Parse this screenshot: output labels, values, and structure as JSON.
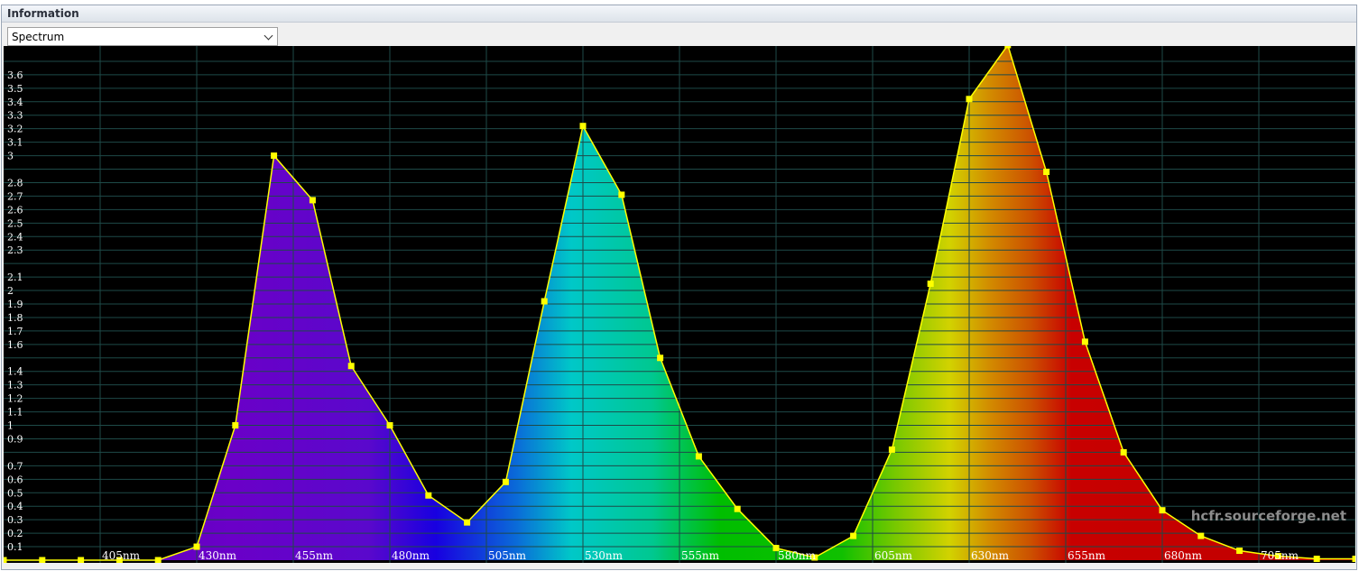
{
  "panel": {
    "title": "Information"
  },
  "selector": {
    "value": "Spectrum"
  },
  "watermark": "hcfr.sourceforge.net",
  "chart_data": {
    "type": "area",
    "title": "",
    "xlabel": "",
    "ylabel": "",
    "x_unit": "nm",
    "xlim": [
      380,
      730
    ],
    "ylim": [
      0,
      3.8
    ],
    "grid": true,
    "x_tick_labels": [
      "405nm",
      "430nm",
      "455nm",
      "480nm",
      "505nm",
      "530nm",
      "555nm",
      "580nm",
      "605nm",
      "630nm",
      "655nm",
      "680nm",
      "705nm"
    ],
    "y_tick_labels": [
      "0.1",
      "0.2",
      "0.3",
      "0.4",
      "0.5",
      "0.6",
      "0.7",
      "0.9",
      "1",
      "1.1",
      "1.2",
      "1.3",
      "1.4",
      "1.6",
      "1.7",
      "1.8",
      "1.9",
      "2",
      "2.1",
      "2.3",
      "2.4",
      "2.5",
      "2.6",
      "2.7",
      "2.8",
      "3",
      "3.1",
      "3.2",
      "3.3",
      "3.4",
      "3.5",
      "3.6"
    ],
    "colors": {
      "curve": "#ffff00",
      "markers": "#ffff00",
      "background": "#000000",
      "grid": "#1e4a48"
    },
    "x": [
      380,
      390,
      400,
      410,
      420,
      430,
      440,
      450,
      460,
      470,
      480,
      490,
      500,
      510,
      520,
      530,
      540,
      550,
      560,
      570,
      580,
      590,
      600,
      610,
      620,
      630,
      640,
      650,
      660,
      670,
      680,
      690,
      700,
      710,
      720,
      730
    ],
    "values": [
      0.0,
      0.0,
      0.0,
      0.0,
      0.0,
      0.1,
      1.0,
      3.0,
      2.67,
      1.44,
      1.0,
      0.48,
      0.28,
      0.58,
      1.92,
      3.22,
      2.71,
      1.5,
      0.77,
      0.38,
      0.09,
      0.02,
      0.18,
      0.82,
      2.05,
      3.42,
      3.82,
      2.88,
      1.62,
      0.8,
      0.37,
      0.18,
      0.07,
      0.03,
      0.01,
      0.01
    ]
  }
}
